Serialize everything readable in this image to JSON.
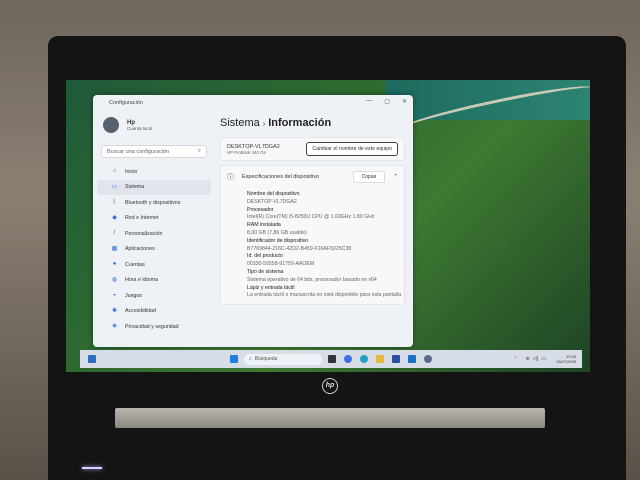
{
  "window": {
    "title": "Configuración",
    "controls": [
      "—",
      "▢",
      "✕"
    ]
  },
  "user": {
    "name": "Hp",
    "account_type": "Cuenta local"
  },
  "search": {
    "placeholder": "Buscar una configuración"
  },
  "sidebar": {
    "items": [
      {
        "label": "Inicio",
        "icon": "home-icon",
        "active": false
      },
      {
        "label": "Sistema",
        "icon": "monitor-icon",
        "active": true
      },
      {
        "label": "Bluetooth y dispositivos",
        "icon": "bluetooth-icon",
        "active": false
      },
      {
        "label": "Red e Internet",
        "icon": "wifi-icon",
        "active": false
      },
      {
        "label": "Personalización",
        "icon": "brush-icon",
        "active": false
      },
      {
        "label": "Aplicaciones",
        "icon": "apps-icon",
        "active": false
      },
      {
        "label": "Cuentas",
        "icon": "person-icon",
        "active": false
      },
      {
        "label": "Hora e idioma",
        "icon": "globe-icon",
        "active": false
      },
      {
        "label": "Juegos",
        "icon": "gamepad-icon",
        "active": false
      },
      {
        "label": "Accesibilidad",
        "icon": "accessibility-icon",
        "active": false
      },
      {
        "label": "Privacidad y seguridad",
        "icon": "shield-icon",
        "active": false
      }
    ]
  },
  "breadcrumb": {
    "parent": "Sistema",
    "separator": "›",
    "current": "Información"
  },
  "device": {
    "name": "DESKTOP-VL7DGA2",
    "model": "HP ProBook 440 G5",
    "rename_button": "Cambiar el nombre de este equipo"
  },
  "specs": {
    "title": "Especificaciones del dispositivo",
    "copy_button": "Copiar",
    "rows": [
      {
        "key": "Nombre del dispositivo",
        "value": "DESKTOP-VL7DGA2"
      },
      {
        "key": "Procesador",
        "value": "Intel(R) Core(TM) i5-8250U CPU @ 1.60GHz   1.80 GHz"
      },
      {
        "key": "RAM instalada",
        "value": "8,00 GB (7,86 GB usable)"
      },
      {
        "key": "Identificador de dispositivo",
        "value": "B7769844-216C-42D2-B459-F16AF5025C38"
      },
      {
        "key": "Id. del producto",
        "value": "00330-50558-91759-AAOEM"
      },
      {
        "key": "Tipo de sistema",
        "value": "Sistema operativo de 64 bits, procesador basado en x64"
      },
      {
        "key": "Lápiz y entrada táctil",
        "value": "La entrada táctil o manuscrita no está disponible para esta pantalla"
      }
    ]
  },
  "taskbar": {
    "search_label": "Búsqueda",
    "time": "19:35",
    "date": "13/07/2025"
  },
  "brand": {
    "logo": "hp"
  }
}
